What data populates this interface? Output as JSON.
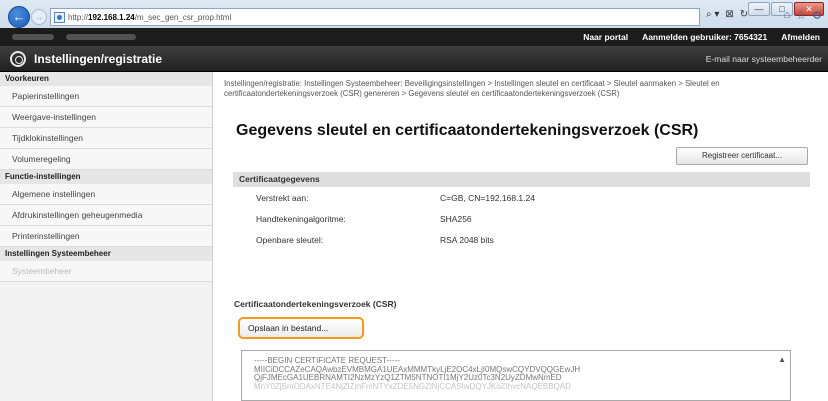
{
  "browser": {
    "url_prefix": "http://",
    "url_host": "192.168.1.24",
    "url_path": "/m_sec_gen_csr_prop.html",
    "addr_tools": [
      "⌕ ▾",
      "⊠",
      "↻"
    ],
    "icons": [
      "⌂",
      "☆",
      "⚙"
    ],
    "window_buttons": [
      "—",
      "□",
      "✕"
    ]
  },
  "topbar": {
    "portal": "Naar portal",
    "logged_in": "Aanmelden gebruiker: 7654321",
    "logout": "Afmelden"
  },
  "header": {
    "title": "Instellingen/registratie",
    "mail_admin": "E-mail naar systeembeheerder"
  },
  "sidebar": {
    "heading_preferences": "Voorkeuren",
    "items_preferences": [
      "Papierinstellingen",
      "Weergave-instellingen",
      "Tijdklokinstellingen",
      "Volumeregeling"
    ],
    "heading_functions": "Functie-instellingen",
    "items_functions": [
      "Algemene instellingen",
      "Afdrukinstellingen geheugenmedia",
      "Printerinstellingen"
    ],
    "heading_admin": "Instellingen Systeembeheer",
    "items_admin": [
      "Systeembeheer"
    ]
  },
  "main": {
    "breadcrumb": "Instellingen/registratie: Instellingen Systeembeheer: Beveiligingsinstellingen > Instellingen sleutel en certificaat > Sleutel aanmaken > Sleutel en certificaatondertekeningsverzoek (CSR) genereren > Gegevens sleutel en certificaatondertekeningsverzoek (CSR)",
    "title": "Gegevens sleutel en certificaatondertekeningsverzoek (CSR)",
    "register_button": "Registreer certificaat...",
    "section_title": "Certificaatgegevens",
    "fields": [
      {
        "key": "Verstrekt aan:",
        "value": "C=GB, CN=192.168.1.24"
      },
      {
        "key": "Handtekeningalgoritme:",
        "value": "SHA256"
      },
      {
        "key": "Openbare sleutel:",
        "value": "RSA 2048 bits"
      }
    ],
    "csr_label": "Certificaatondertekeningsverzoek (CSR)",
    "save_button": "Opslaan in bestand...",
    "csr_lines": [
      "-----BEGIN CERTIFICATE REQUEST-----",
      "MIICiDCCAZeCAQAwbzEVMBMGA1UEAxMMMTkyLjE2OC4xLjI0MQswCQYDVQQGEwJH",
      "QjFJMEcGA1UEBRNAMTI2NzMzYzQ1ZTM5NTNOTI1MjY2Uz0Tc3N2UyZDMwNmED",
      "MnY0ZjBmODAxNTE4NjZlZmFmNTYxZDE5NGZlNjCCASIwDQYJKoZIhvcNAQEBBQAD"
    ],
    "scroll_up": "▲"
  }
}
